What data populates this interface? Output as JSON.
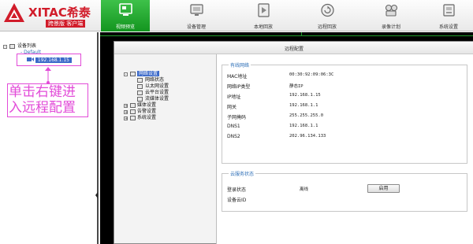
{
  "header": {
    "brand": "XITAC希泰",
    "subtitle": "跨景版 客户端",
    "nav": [
      {
        "label": "视频预览",
        "icon": "monitor-preview-icon",
        "active": true
      },
      {
        "label": "设备管理",
        "icon": "device-manage-icon",
        "active": false
      },
      {
        "label": "本地回放",
        "icon": "local-playback-icon",
        "active": false
      },
      {
        "label": "远程回放",
        "icon": "remote-playback-icon",
        "active": false
      },
      {
        "label": "录像计划",
        "icon": "record-schedule-icon",
        "active": false
      },
      {
        "label": "系统设置",
        "icon": "system-settings-icon",
        "active": false
      }
    ],
    "accent_color": "#1fa52b",
    "brand_color": "#d11c2a"
  },
  "device_tree": {
    "root": "设备列表",
    "group": "Default",
    "device": "192.168.1.15"
  },
  "annotation": {
    "text": "单击右键进入远程配置",
    "color": "#e24bd8"
  },
  "dialog": {
    "title": "远程配置",
    "tree": {
      "network": "网络设置",
      "network_children": [
        "网络状态",
        "以太网设置",
        "云平台设置",
        "流媒体设置"
      ],
      "media": "媒体设置",
      "alarm": "告警设置",
      "system": "系统设置"
    },
    "network_status": {
      "title": "有线网络",
      "rows": [
        {
          "label": "MAC地址",
          "value": "00:30:92:09:06:3C"
        },
        {
          "label": "网络IP类型",
          "value": "静态IP"
        },
        {
          "label": "IP地址",
          "value": "192.168.1.15"
        },
        {
          "label": "网关",
          "value": "192.168.1.1"
        },
        {
          "label": "子网掩码",
          "value": "255.255.255.0"
        },
        {
          "label": "DNS1",
          "value": "192.168.1.1"
        },
        {
          "label": "DNS2",
          "value": "202.96.134.133"
        }
      ]
    },
    "cloud_status": {
      "title": "云服务状态",
      "login_label": "登录状态",
      "login_value": "离线",
      "enable_button": "启用",
      "device_id_label": "设备云ID"
    }
  }
}
